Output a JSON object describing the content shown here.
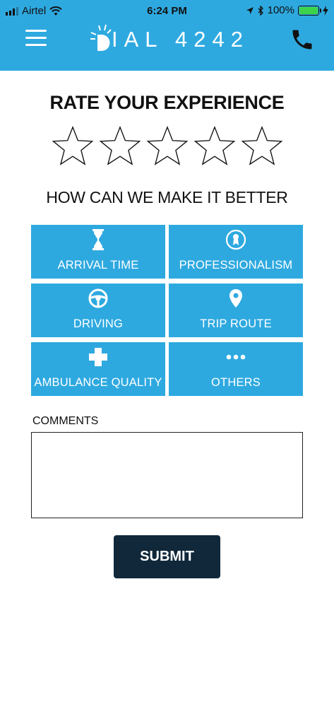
{
  "status_bar": {
    "carrier": "Airtel",
    "time": "6:24 PM",
    "battery": "100%",
    "battery_color": "#3cd34a"
  },
  "header": {
    "brand_color": "#2ea9e0",
    "logo_text": "IAL 4242",
    "menu_icon": "hamburger-menu-icon",
    "call_icon": "phone-icon"
  },
  "rating": {
    "title": "RATE YOUR EXPERIENCE",
    "stars_total": 5,
    "stars_selected": 0
  },
  "improve": {
    "title": "HOW CAN WE MAKE IT BETTER",
    "options": [
      {
        "label": "ARRIVAL TIME",
        "icon": "hourglass-icon"
      },
      {
        "label": "PROFESSIONALISM",
        "icon": "badge-icon"
      },
      {
        "label": "DRIVING",
        "icon": "steering-wheel-icon"
      },
      {
        "label": "TRIP ROUTE",
        "icon": "location-pin-icon"
      },
      {
        "label": "AMBULANCE QUALITY",
        "icon": "medical-cross-icon"
      },
      {
        "label": "OTHERS",
        "icon": "more-dots-icon"
      }
    ]
  },
  "comments": {
    "label": "COMMENTS",
    "value": "",
    "placeholder": ""
  },
  "submit": {
    "label": "SUBMIT",
    "color": "#10283a"
  }
}
